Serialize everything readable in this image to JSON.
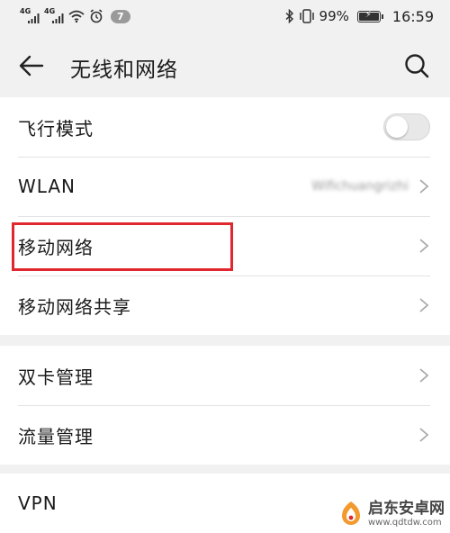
{
  "status_bar": {
    "signal1_tag": "4G",
    "signal2_tag": "4G",
    "notification_count": "7",
    "battery_percent": "99%",
    "battery_level": 0.99,
    "time": "16:59"
  },
  "header": {
    "title": "无线和网络"
  },
  "groups": [
    {
      "items": [
        {
          "label": "飞行模式",
          "type": "toggle",
          "enabled": false
        },
        {
          "label": "WLAN",
          "value": "Wifichuangrizhi",
          "type": "link"
        },
        {
          "label": "移动网络",
          "type": "link",
          "highlighted": true
        },
        {
          "label": "移动网络共享",
          "type": "link"
        }
      ]
    },
    {
      "items": [
        {
          "label": "双卡管理",
          "type": "link"
        },
        {
          "label": "流量管理",
          "type": "link"
        }
      ]
    },
    {
      "items": [
        {
          "label": "VPN",
          "type": "link"
        }
      ]
    }
  ],
  "watermark": {
    "name": "启东安卓网",
    "url": "www.qdtdw.com"
  },
  "colors": {
    "background": "#f1f1f1",
    "highlight_border": "#e0262e"
  }
}
